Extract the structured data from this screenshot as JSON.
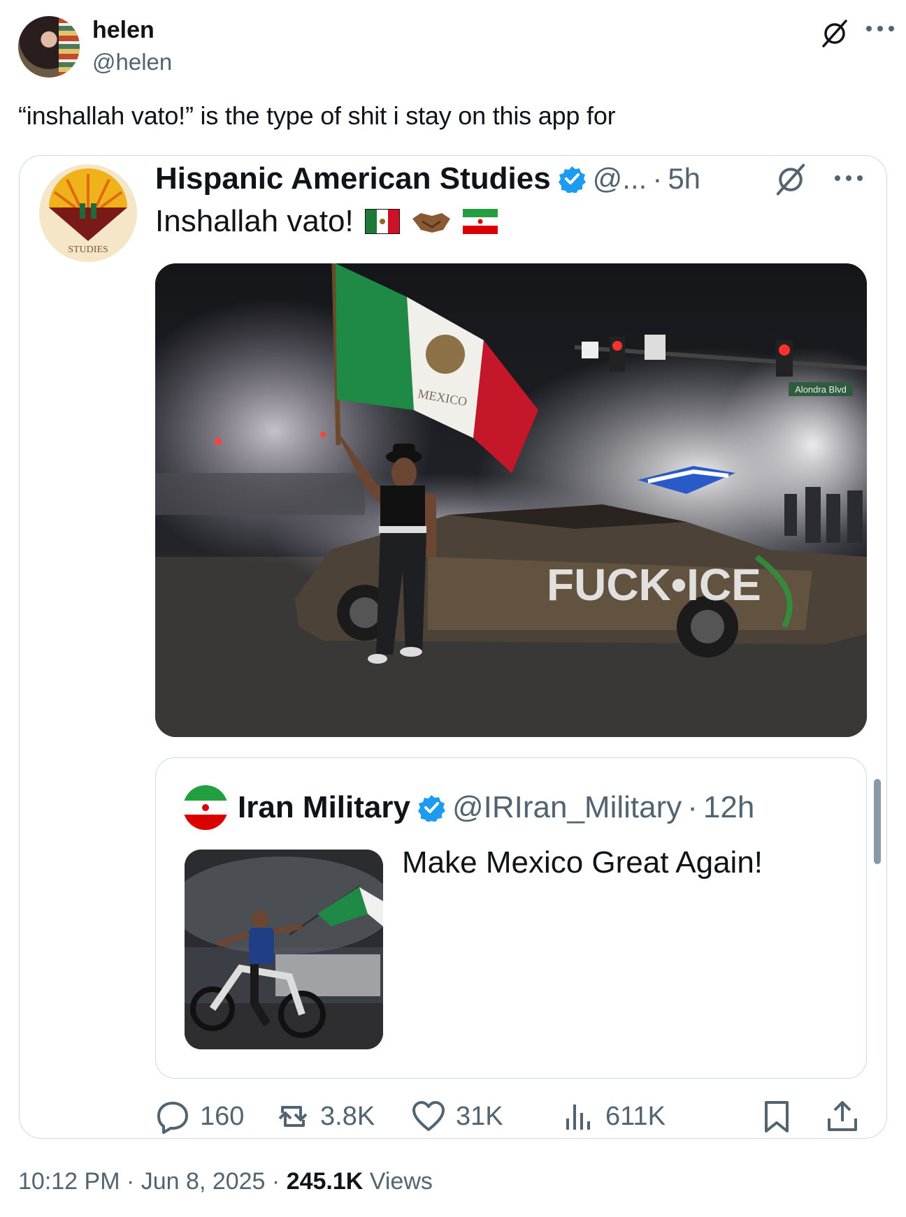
{
  "post": {
    "author_name": "helen",
    "author_handle": "@helen",
    "text": "“inshallah vato!” is the type of shit i stay on this app for",
    "time": "10:12 PM",
    "date": "Jun 8, 2025",
    "views_count": "245.1K",
    "views_label": "Views",
    "separator": "·"
  },
  "quoted": {
    "author_name": "Hispanic American Studies",
    "author_handle": "@...",
    "time_ago": "5h",
    "text": "Inshallah vato!",
    "emojis": [
      "mexico-flag",
      "handshake",
      "iran-flag"
    ],
    "photo_signs": {
      "flag_text": "MEXICO",
      "car_graffiti": "FUCK•ICE",
      "street_sign": "Alondra Blvd"
    },
    "logo_text": "STUDIES",
    "metrics": {
      "replies": "160",
      "reposts": "3.8K",
      "likes": "31K",
      "views": "611K"
    }
  },
  "nested_quote": {
    "author_name": "Iran Military",
    "author_handle": "@IRIran_Military",
    "time_ago": "12h",
    "text": "Make Mexico Great Again!"
  },
  "colors": {
    "verified": "#1d9bf0",
    "secondary_text": "#536471",
    "border": "#cfd9de"
  },
  "icons": [
    "grok-icon",
    "more-icon",
    "verified-icon",
    "reply-icon",
    "repost-icon",
    "like-icon",
    "views-icon",
    "bookmark-icon",
    "share-icon"
  ]
}
